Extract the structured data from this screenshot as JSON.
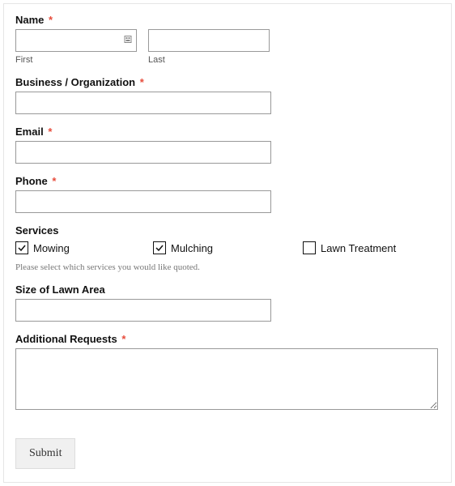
{
  "fields": {
    "name": {
      "label": "Name",
      "required": true,
      "first": {
        "sublabel": "First",
        "value": ""
      },
      "last": {
        "sublabel": "Last",
        "value": ""
      }
    },
    "business": {
      "label": "Business / Organization",
      "required": true,
      "value": ""
    },
    "email": {
      "label": "Email",
      "required": true,
      "value": ""
    },
    "phone": {
      "label": "Phone",
      "required": true,
      "value": ""
    },
    "services": {
      "label": "Services",
      "options": [
        {
          "label": "Mowing",
          "checked": true
        },
        {
          "label": "Mulching",
          "checked": true
        },
        {
          "label": "Lawn Treatment",
          "checked": false
        }
      ],
      "hint": "Please select which services you would like quoted."
    },
    "lawn_size": {
      "label": "Size of Lawn Area",
      "required": false,
      "value": ""
    },
    "additional": {
      "label": "Additional Requests",
      "required": true,
      "value": ""
    }
  },
  "submit_label": "Submit",
  "asterisk": "*"
}
